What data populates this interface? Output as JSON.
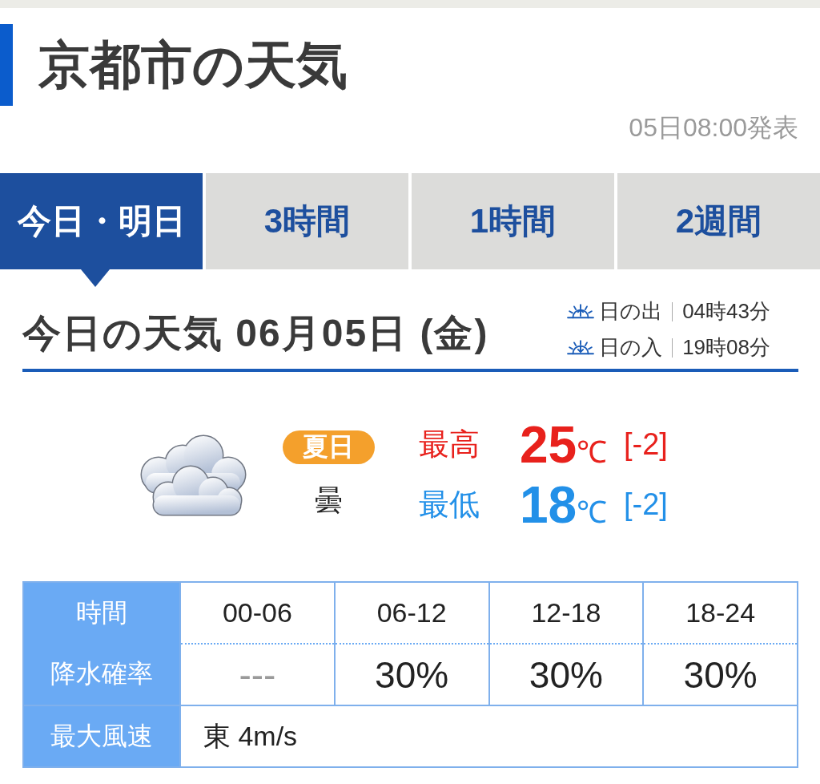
{
  "header": {
    "title": "京都市の天気",
    "issued": "05日08:00発表"
  },
  "tabs": [
    {
      "label": "今日・明日",
      "selected": true
    },
    {
      "label": "3時間",
      "selected": false
    },
    {
      "label": "1時間",
      "selected": false
    },
    {
      "label": "2週間",
      "selected": false
    }
  ],
  "today": {
    "heading": "今日の天気 06月05日 (金)",
    "sun": [
      {
        "kind": "sunrise",
        "label": "日の出",
        "time": "04時43分"
      },
      {
        "kind": "sunset",
        "label": "日の入",
        "time": "19時08分"
      }
    ],
    "badge": "夏日",
    "condition": "曇",
    "temperatures": [
      {
        "kind": "high",
        "label": "最高",
        "value": "25",
        "unit": "℃",
        "change": "[-2]"
      },
      {
        "kind": "low",
        "label": "最低",
        "value": "18",
        "unit": "℃",
        "change": "[-2]"
      }
    ]
  },
  "forecast_table": {
    "rows": [
      {
        "kind": "time",
        "header": "時間",
        "cells": [
          {
            "text": "00-06",
            "muted": false
          },
          {
            "text": "06-12",
            "muted": false
          },
          {
            "text": "12-18",
            "muted": false
          },
          {
            "text": "18-24",
            "muted": false
          }
        ]
      },
      {
        "kind": "precipitation",
        "header": "降水確率",
        "cells": [
          {
            "text": "---",
            "muted": true
          },
          {
            "text": "30%",
            "muted": false
          },
          {
            "text": "30%",
            "muted": false
          },
          {
            "text": "30%",
            "muted": false
          }
        ]
      }
    ]
  },
  "wind": {
    "header": "最大風速",
    "value": "東 4m/s"
  }
}
